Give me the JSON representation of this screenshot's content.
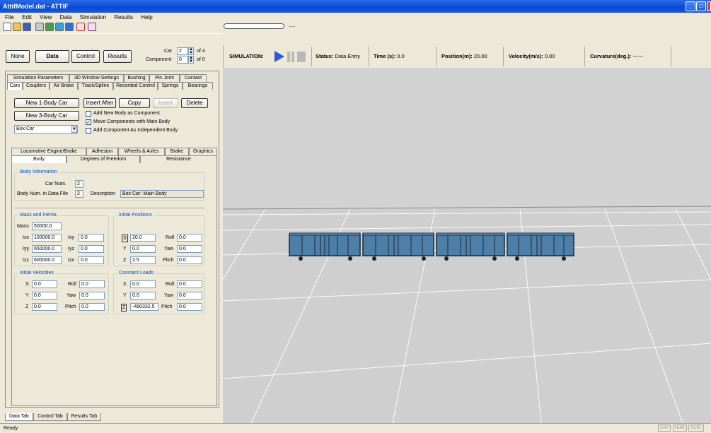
{
  "window": {
    "title": "AttifModel.dat - ATTIF",
    "min": "_",
    "max": "□",
    "close": "×"
  },
  "menu": [
    "File",
    "Edit",
    "View",
    "Data",
    "Simulation",
    "Results",
    "Help"
  ],
  "topbar": {
    "progress_text": "....."
  },
  "mode": {
    "none": "None",
    "data": "Data",
    "control": "Control",
    "results": "Results",
    "car_label": "Car",
    "car_value": "2",
    "car_of": "of 4",
    "component_label": "Component",
    "component_value": "0",
    "component_of": "of 0"
  },
  "simulation": {
    "label": "SIMULATION:",
    "status_label": "Status:",
    "status": "Data Entry",
    "time_label": "Time (s):",
    "time": "0.0",
    "position_label": "Position(m):",
    "position": "20.00",
    "velocity_label": "Velocity(m/s):",
    "velocity": "0.00",
    "curvature_label": "Curvature(deg.):",
    "curvature": "------"
  },
  "tabs_row1": [
    "Simulation Parameters",
    "3D Window Settings",
    "Bushing",
    "Pin Joint",
    "Contact"
  ],
  "tabs_row2": [
    "Cars",
    "Couplers",
    "Air Brake",
    "Track/Spline",
    "Recorded Control",
    "Springs",
    "Bearings"
  ],
  "cars": {
    "new1": "New 1-Body Car",
    "new3": "New 3-Body Car",
    "insert_after": "Insert After",
    "copy": "Copy",
    "insert": "Insert",
    "delete": "Delete",
    "type": "Box Car",
    "opt1": "Add New Body as Component",
    "opt2": "Move Components with Main Body",
    "opt3": "Add Component As Independent Body"
  },
  "subtabs_row1": [
    "Locomotive Engine/Brake",
    "Adhesion",
    "Wheels & Axles",
    "Brake",
    "Graphics"
  ],
  "subtabs_row2": [
    "Body",
    "Degrees of Freedom",
    "Resistance"
  ],
  "body_info": {
    "title": "Body Information",
    "car_num_label": "Car Num.",
    "car_num": "2",
    "body_num_label": "Body Num. in Data File",
    "body_num": "2",
    "desc_label": "Description",
    "desc": "Box Car- Main Body"
  },
  "mass": {
    "title": "Mass and Inertia",
    "mass_label": "Mass",
    "mass": "50000.0",
    "ixx_label": "Ixx",
    "ixx": "100000.0",
    "iyy_label": "Iyy",
    "iyy": "650000.0",
    "izz_label": "Izz",
    "izz": "600000.0",
    "ixy_label": "Ixy",
    "ixy": "0.0",
    "iyz_label": "Iyz",
    "iyz": "0.0",
    "izx_label": "Izx",
    "izx": "0.0"
  },
  "init_pos": {
    "title": "Initial Positions",
    "s_label": "S",
    "s": "20.0",
    "y_label": "Y",
    "y": "0.0",
    "z_label": "Z",
    "z": "2.5",
    "roll_label": "Roll",
    "roll": "0.0",
    "yaw_label": "Yaw",
    "yaw": "0.0",
    "pitch_label": "Pitch",
    "pitch": "0.0"
  },
  "init_vel": {
    "title": "Initial Velocities",
    "s_label": "S",
    "s": "0.0",
    "y_label": "Y",
    "y": "0.0",
    "z_label": "Z",
    "z": "0.0",
    "roll_label": "Roll",
    "roll": "0.0",
    "yaw_label": "Yaw",
    "yaw": "0.0",
    "pitch_label": "Pitch",
    "pitch": "0.0"
  },
  "loads": {
    "title": "Constant Loads",
    "x_label": "X",
    "x": "0.0",
    "y_label": "Y",
    "y": "0.0",
    "z_label": "Z",
    "z": "-490332.5",
    "roll_label": "Roll",
    "roll": "0.0",
    "yaw_label": "Yaw",
    "yaw": "0.0",
    "pitch_label": "Pitch",
    "pitch": "0.0"
  },
  "bottom_tabs": [
    "Data Tab",
    "Control Tab",
    "Results Tab"
  ],
  "status": {
    "text": "Ready",
    "cap": "CAP",
    "num": "NUM",
    "scrl": "SCRL"
  },
  "colors": {
    "car_body": "#4d7fa8",
    "title_blue": "#0a4ad4"
  }
}
